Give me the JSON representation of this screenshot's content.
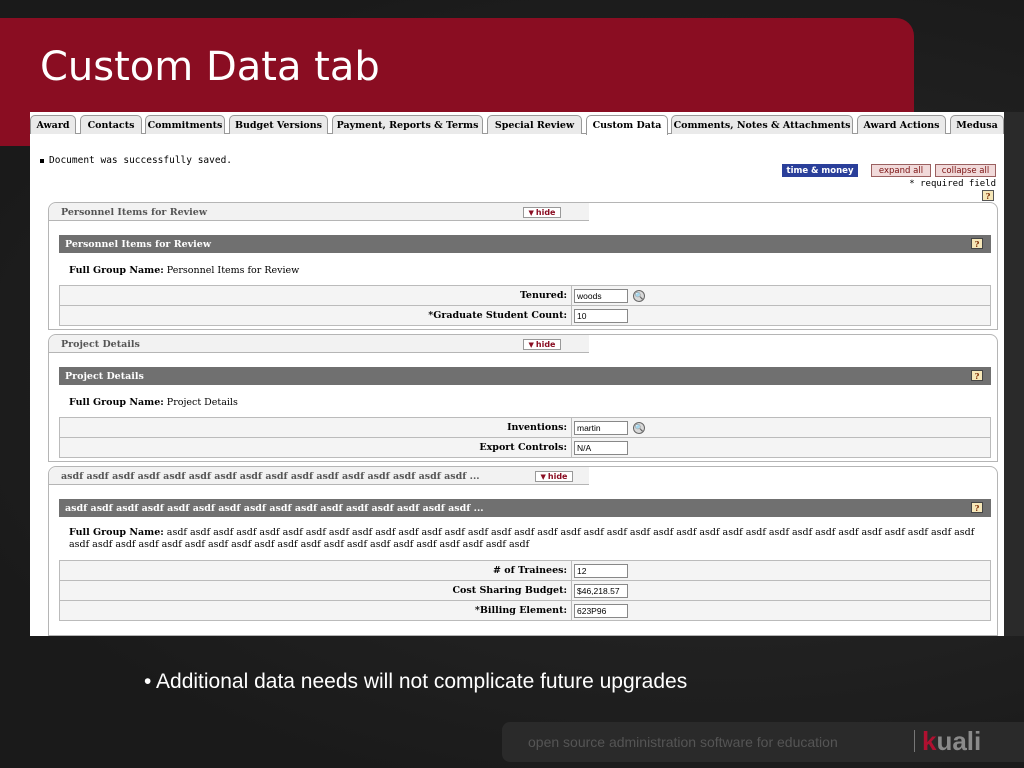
{
  "slide": {
    "title": "Custom Data tab",
    "bullet": "• Additional data needs will not complicate future upgrades",
    "footer": "open source administration software for education",
    "logo_k": "k",
    "logo_rest": "uali"
  },
  "tabs": [
    {
      "label": "Award"
    },
    {
      "label": "Contacts"
    },
    {
      "label": "Commitments"
    },
    {
      "label": "Budget Versions"
    },
    {
      "label": "Payment, Reports & Terms"
    },
    {
      "label": "Special Review"
    },
    {
      "label": "Custom Data",
      "active": true
    },
    {
      "label": "Comments, Notes & Attachments"
    },
    {
      "label": "Award Actions"
    },
    {
      "label": "Medusa"
    }
  ],
  "messages": {
    "saved": "Document was successfully saved."
  },
  "buttons": {
    "time_money": "time & money",
    "expand_all": "expand all",
    "collapse_all": "collapse all",
    "hide": "hide"
  },
  "required_field": "* required field",
  "help_icon": "?",
  "panels": {
    "personnel": {
      "tab_label": "Personnel Items for Review",
      "section_title": "Personnel Items for Review",
      "group_label": "Full Group Name:",
      "group_name": "Personnel Items for Review",
      "fields": [
        {
          "label": "Tenured:",
          "value": "woods",
          "lookup": true
        },
        {
          "label": "*Graduate Student Count:",
          "value": "10"
        }
      ]
    },
    "project": {
      "tab_label": "Project Details",
      "section_title": "Project Details",
      "group_label": "Full Group Name:",
      "group_name": "Project Details",
      "fields": [
        {
          "label": "Inventions:",
          "value": "martin",
          "lookup": true
        },
        {
          "label": "Export Controls:",
          "value": "N/A"
        }
      ]
    },
    "asdf": {
      "tab_label": "asdf asdf asdf asdf asdf asdf asdf asdf asdf asdf asdf asdf asdf asdf asdf asdf ...",
      "section_title": "asdf asdf asdf asdf asdf asdf asdf asdf asdf asdf asdf asdf asdf asdf asdf asdf ...",
      "group_label": "Full Group Name:",
      "group_name": "asdf asdf asdf asdf asdf asdf asdf asdf asdf asdf asdf asdf asdf asdf asdf asdf asdf asdf asdf asdf asdf asdf asdf asdf asdf asdf asdf asdf asdf asdf asdf asdf asdf asdf asdf asdf asdf asdf asdf asdf asdf asdf asdf asdf asdf asdf asdf asdf asdf asdf asdf asdf asdf asdf asdf",
      "fields": [
        {
          "label": "# of Trainees:",
          "value": "12"
        },
        {
          "label": "Cost Sharing Budget:",
          "value": "$46,218.57"
        },
        {
          "label": "*Billing Element:",
          "value": "623P96"
        }
      ]
    }
  },
  "colors": {
    "title_band": "#8a0d22",
    "time_money_button": "#2a3f9a",
    "section_bar": "#707070"
  }
}
